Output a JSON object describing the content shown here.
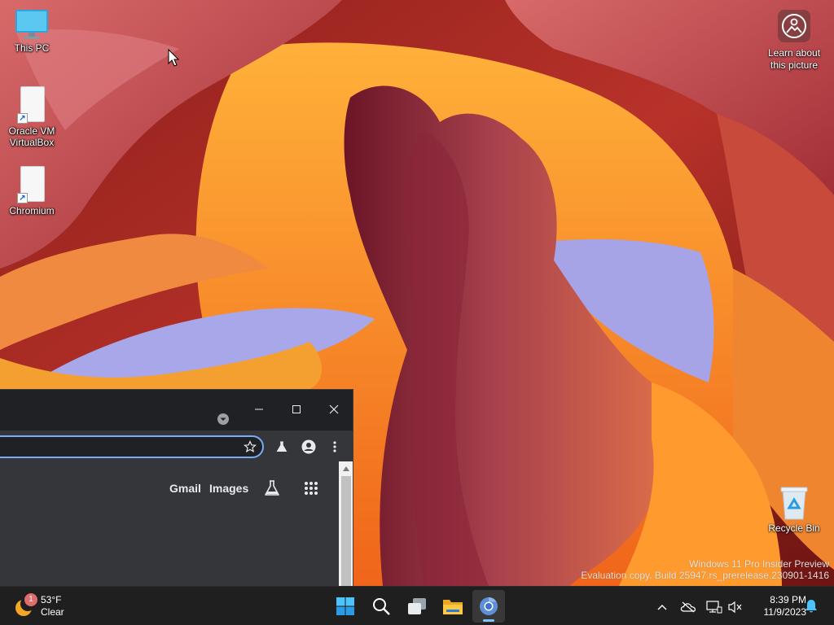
{
  "desktop": {
    "icons": [
      {
        "label": "This PC",
        "icon": "monitor-icon"
      },
      {
        "label": "Oracle VM\nVirtualBox",
        "icon": "file-shortcut-icon"
      },
      {
        "label": "Chromium",
        "icon": "file-shortcut-icon"
      }
    ],
    "learn_about_picture": {
      "label": "Learn about\nthis picture",
      "icon": "camera-icon"
    },
    "recycle_bin": {
      "label": "Recycle Bin",
      "icon": "recycle-bin-icon"
    },
    "watermark": {
      "line1": "Windows 11 Pro Insider Preview",
      "line2": "Evaluation copy. Build 25947.rs_prerelease.230901-1416"
    }
  },
  "browser": {
    "title_controls": {
      "minimize": "minimize-icon",
      "maximize": "maximize-icon",
      "close": "close-icon"
    },
    "toolbar": {
      "bookmark_icon": "star-icon",
      "labs_icon": "flask-icon",
      "profile_icon": "profile-icon",
      "menu_icon": "kebab-menu-icon"
    },
    "content": {
      "gmail_label": "Gmail",
      "images_label": "Images",
      "labs_icon": "flask-icon",
      "apps_icon": "apps-grid-icon"
    }
  },
  "taskbar": {
    "weather": {
      "temp": "53°F",
      "condition": "Clear",
      "badge": "1"
    },
    "apps": [
      "start-icon",
      "search-icon",
      "task-view-icon",
      "file-explorer-icon",
      "chromium-icon"
    ],
    "tray": [
      "chevron-up-icon",
      "onedrive-icon",
      "network-icon",
      "volume-muted-icon"
    ],
    "clock": {
      "time": "8:39 PM",
      "date": "11/9/2023"
    }
  },
  "colors": {
    "accent": "#7baaf7",
    "taskbar": "#1f1f1f",
    "browser_bg": "#35363a"
  }
}
